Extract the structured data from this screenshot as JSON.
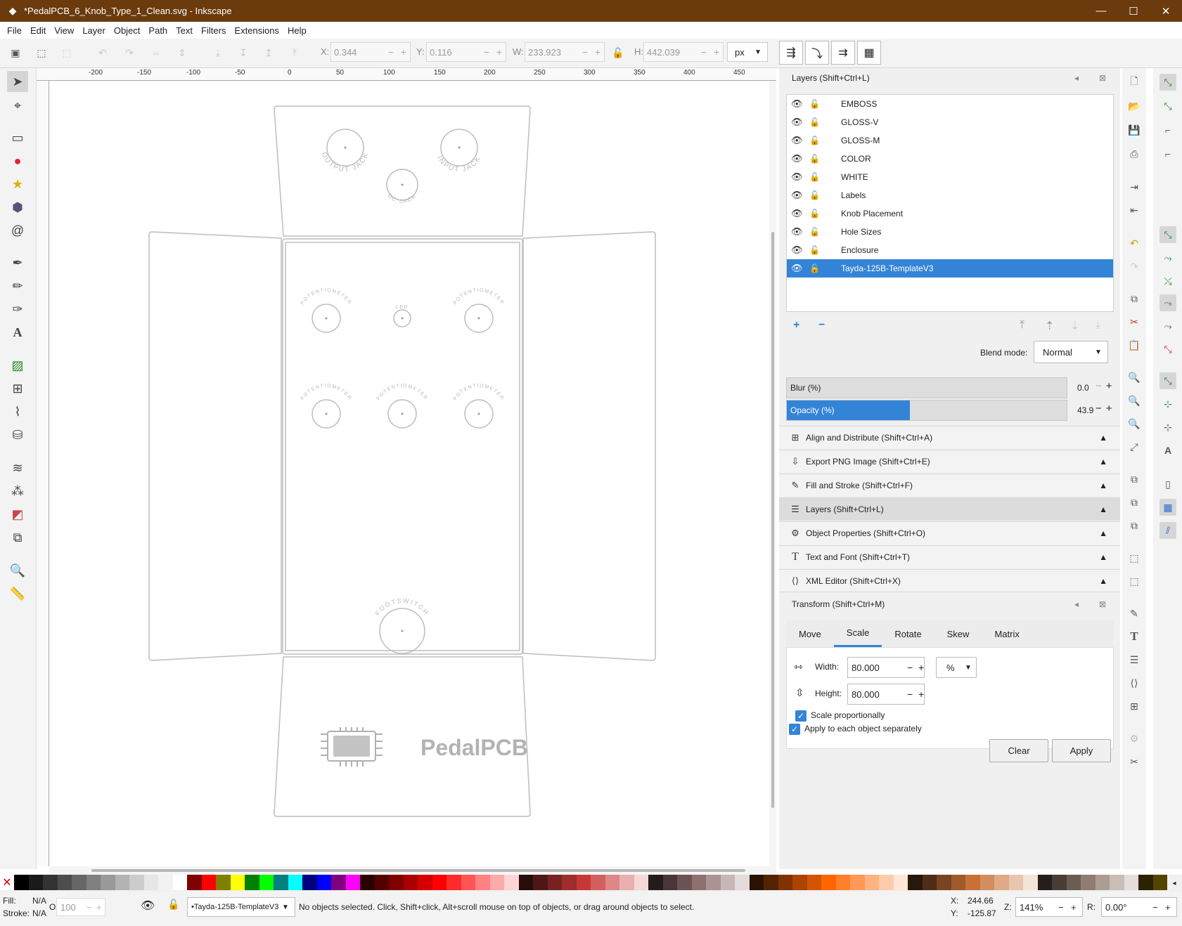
{
  "window": {
    "title": "*PedalPCB_6_Knob_Type_1_Clean.svg - Inkscape",
    "minimize": "—",
    "maximize": "☐",
    "close": "✕"
  },
  "menu": [
    "File",
    "Edit",
    "View",
    "Layer",
    "Object",
    "Path",
    "Text",
    "Filters",
    "Extensions",
    "Help"
  ],
  "toolbar": {
    "x_label": "X:",
    "x_value": "0.344",
    "y_label": "Y:",
    "y_value": "0.116",
    "w_label": "W:",
    "w_value": "233.923",
    "h_label": "H:",
    "h_value": "442.039",
    "unit": "px"
  },
  "ruler_labels": [
    "-200",
    "-150",
    "-100",
    "-50",
    "0",
    "50",
    "100",
    "150",
    "200",
    "250",
    "300",
    "350",
    "400",
    "450"
  ],
  "canvas": {
    "labels": {
      "output_jack": "OUTPUT JACK",
      "input_jack": "INPUT JACK",
      "dc_jack": "DC JACK",
      "potentiometer": "POTENTIOMETER",
      "led": "LED",
      "footswitch": "FOOTSWITCH",
      "logo": "PedalPCB"
    }
  },
  "layers_panel": {
    "title": "Layers (Shift+Ctrl+L)",
    "layers": [
      {
        "name": "EMBOSS",
        "selected": false
      },
      {
        "name": "GLOSS-V",
        "selected": false
      },
      {
        "name": "GLOSS-M",
        "selected": false
      },
      {
        "name": "COLOR",
        "selected": false
      },
      {
        "name": "WHITE",
        "selected": false
      },
      {
        "name": "Labels",
        "selected": false
      },
      {
        "name": "Knob Placement",
        "selected": false
      },
      {
        "name": "Hole Sizes",
        "selected": false
      },
      {
        "name": "Enclosure",
        "selected": false
      },
      {
        "name": "Tayda-125B-TemplateV3",
        "selected": true
      }
    ],
    "blend_label": "Blend mode:",
    "blend_value": "Normal",
    "blur_label": "Blur (%)",
    "blur_value": "0.0",
    "opacity_label": "Opacity (%)",
    "opacity_value": "43.9",
    "opacity_fraction": 0.439
  },
  "collapsed_panels": [
    {
      "icon": "align-icon",
      "glyph": "⊞",
      "label": "Align and Distribute (Shift+Ctrl+A)",
      "highlight": false
    },
    {
      "icon": "export-icon",
      "glyph": "⇩",
      "label": "Export PNG Image (Shift+Ctrl+E)",
      "highlight": false
    },
    {
      "icon": "fill-stroke-icon",
      "glyph": "✎",
      "label": "Fill and Stroke (Shift+Ctrl+F)",
      "highlight": false
    },
    {
      "icon": "layers-icon",
      "glyph": "☰",
      "label": "Layers (Shift+Ctrl+L)",
      "highlight": true
    },
    {
      "icon": "object-properties-icon",
      "glyph": "⚙",
      "label": "Object Properties (Shift+Ctrl+O)",
      "highlight": false
    },
    {
      "icon": "text-font-icon",
      "glyph": "T",
      "label": "Text and Font (Shift+Ctrl+T)",
      "highlight": false
    },
    {
      "icon": "xml-editor-icon",
      "glyph": "⟨⟩",
      "label": "XML Editor (Shift+Ctrl+X)",
      "highlight": false
    }
  ],
  "transform_panel": {
    "title": "Transform (Shift+Ctrl+M)",
    "tabs": [
      "Move",
      "Scale",
      "Rotate",
      "Skew",
      "Matrix"
    ],
    "active_tab": "Scale",
    "width_label": "Width:",
    "width_value": "80.000",
    "height_label": "Height:",
    "height_value": "80.000",
    "unit": "%",
    "scale_prop_label": "Scale proportionally",
    "apply_each_label": "Apply to each object separately",
    "clear_label": "Clear",
    "apply_label": "Apply"
  },
  "palette": [
    "#000000",
    "#1a1a1a",
    "#333333",
    "#4d4d4d",
    "#666666",
    "#808080",
    "#999999",
    "#b3b3b3",
    "#cccccc",
    "#e6e6e6",
    "#f2f2f2",
    "#ffffff",
    "#800000",
    "#ff0000",
    "#808000",
    "#ffff00",
    "#008000",
    "#00ff00",
    "#008080",
    "#00ffff",
    "#000080",
    "#0000ff",
    "#800080",
    "#ff00ff",
    "#2b0000",
    "#550000",
    "#800000",
    "#aa0000",
    "#d40000",
    "#ff0000",
    "#ff2a2a",
    "#ff5555",
    "#ff8080",
    "#ffaaaa",
    "#ffd5d5",
    "#280b0b",
    "#501616",
    "#782121",
    "#a02c2c",
    "#c83737",
    "#d35f5f",
    "#de8787",
    "#e9afaf",
    "#f4d7d7",
    "#241c1c",
    "#483737",
    "#6c5353",
    "#916f6f",
    "#ac9393",
    "#c8b7b7",
    "#e3dbdb",
    "#2b1100",
    "#552200",
    "#803300",
    "#aa4400",
    "#d45500",
    "#ff6600",
    "#ff7f2a",
    "#ff9955",
    "#ffb380",
    "#ffccaa",
    "#ffe6d5",
    "#28170b",
    "#502d16",
    "#784421",
    "#a05a2c",
    "#c87137",
    "#d38d5f",
    "#deaa87",
    "#e9c6af",
    "#f4e3d7",
    "#241f1c",
    "#483e37",
    "#6c5d53",
    "#917c6f",
    "#ac9d93",
    "#c8beb7",
    "#e3dedb",
    "#2b2200",
    "#554400",
    "#806600",
    "#aa8800",
    "#d4aa00",
    "#ffcc00"
  ],
  "status": {
    "fill_label": "Fill:",
    "fill_value": "N/A",
    "stroke_label": "Stroke:",
    "stroke_value": "N/A",
    "o_label": "O:",
    "o_value": "100",
    "layer": "•Tayda-125B-TemplateV3",
    "message": "No objects selected. Click, Shift+click, Alt+scroll mouse on top of objects, or drag around objects to select.",
    "x_label": "X:",
    "x_value": "244.66",
    "y_label": "Y:",
    "y_value": "-125.87",
    "z_label": "Z:",
    "zoom": "141%",
    "r_label": "R:",
    "rotation": "0.00°"
  }
}
